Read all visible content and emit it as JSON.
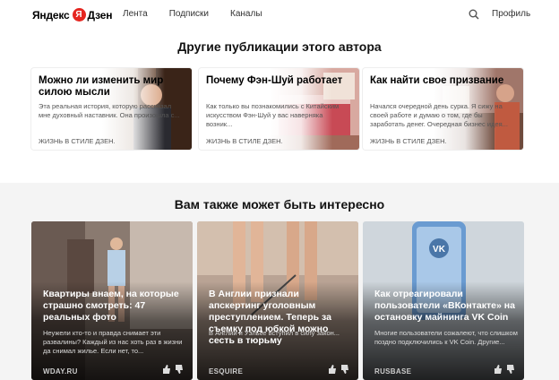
{
  "header": {
    "logo_text": "Яндекс",
    "logo_letter": "Я",
    "logo_text2": "Дзен",
    "nav": [
      "Лента",
      "Подписки",
      "Каналы"
    ],
    "search_icon": "search-icon",
    "profile": "Профиль"
  },
  "section1": {
    "title": "Другие публикации этого автора",
    "items": [
      {
        "title": "Можно ли изменить мир силою мысли",
        "description": "Эта реальная история, которую рассказал мне духовный наставник. Она произошла с...",
        "source": "ЖИЗНЬ В СТИЛЕ ДЗЕН."
      },
      {
        "title": "Почему Фэн-Шуй работает",
        "description": "Как только вы познакомились с Китайским искусством Фэн-Шуй у вас наверняка возник...",
        "source": "ЖИЗНЬ В СТИЛЕ ДЗЕН."
      },
      {
        "title": "Как найти свое призвание",
        "description": "Начался очередной день сурка. Я сижу на своей работе и думаю о том, где бы заработать денег. Очередная бизнес идея...",
        "source": "ЖИЗНЬ В СТИЛЕ ДЗЕН."
      }
    ]
  },
  "section2": {
    "title": "Вам также может быть интересно",
    "cards": [
      {
        "title": "Квартиры внаем, на которые страшно смотреть: 47 реальных фото",
        "description": "Неужели кто-то и правда снимает эти развалины? Каждый из нас хоть раз в жизни да снимал жилье. Если нет, то...",
        "source": "WDAY.RU"
      },
      {
        "title": "В Англии признали апскертинг уголовным преступлением. Теперь за съемку под юбкой можно сесть в тюрьму",
        "description": "В Англии и Уэльсе вступил в силу закон...",
        "source": "ESQUIRE"
      },
      {
        "title": "Как отреагировали пользователи «ВКонтакте» на остановку майнинга VK Coin",
        "description": "Многие пользователи сожалеют, что слишком поздно подключились к VK Coin. Другие...",
        "source": "RUSBASE"
      }
    ]
  }
}
